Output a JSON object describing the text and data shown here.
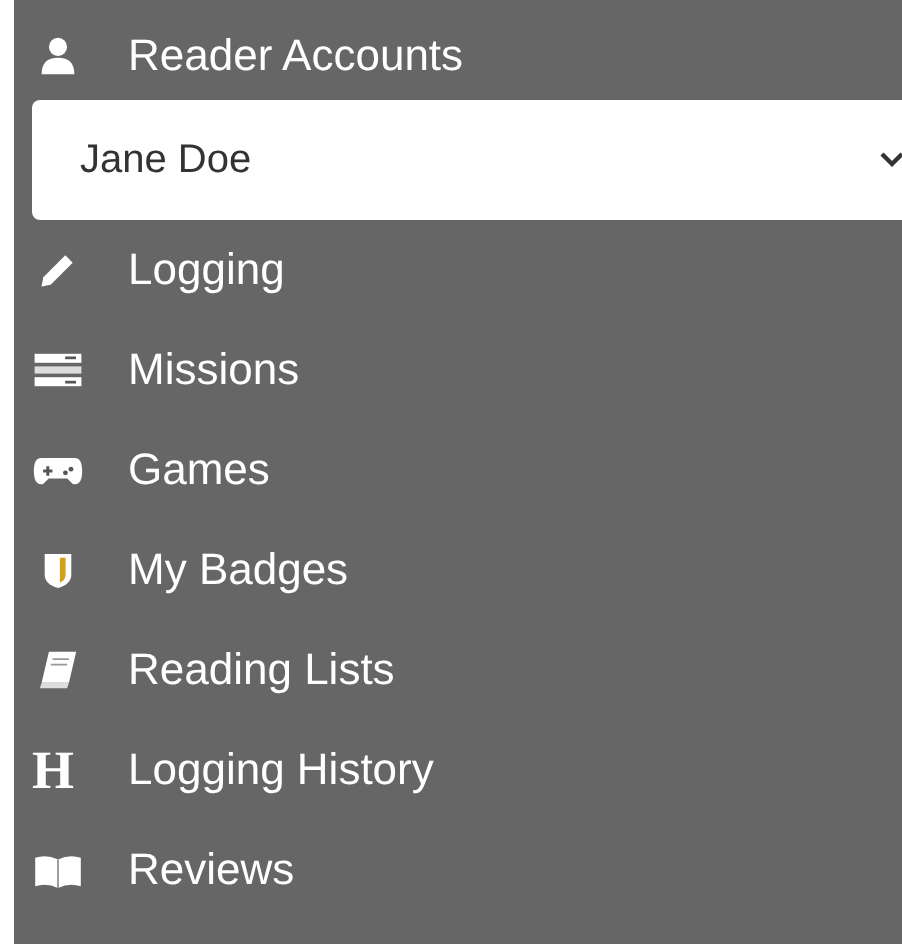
{
  "header": {
    "label": "Reader Accounts"
  },
  "account_select": {
    "value": "Jane Doe"
  },
  "menu": [
    {
      "label": "Logging"
    },
    {
      "label": "Missions"
    },
    {
      "label": "Games"
    },
    {
      "label": "My Badges"
    },
    {
      "label": "Reading Lists"
    },
    {
      "label": "Logging History",
      "glyph": "H"
    },
    {
      "label": "Reviews"
    }
  ]
}
